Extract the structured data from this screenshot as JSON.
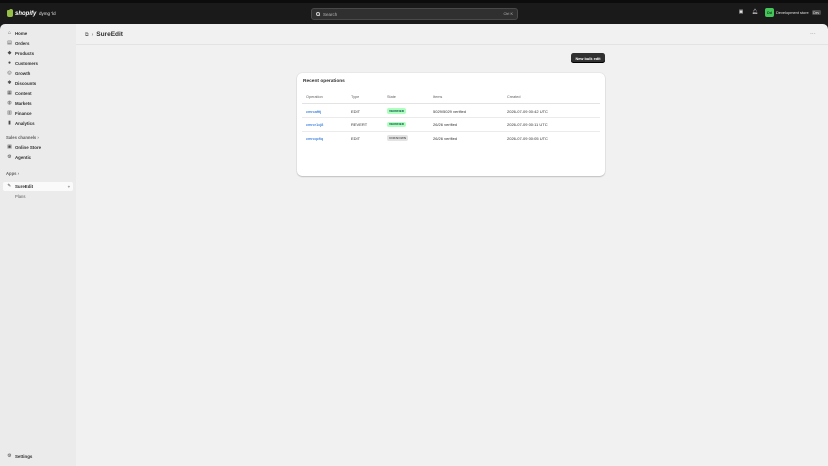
{
  "topbar": {
    "logo_text": "shopify",
    "store_name": "dymg 'ld",
    "search_placeholder": "Search",
    "search_shortcut": "Ctrl K",
    "user_initials": "Dd",
    "user_name": "Development store",
    "user_badge": "Dev"
  },
  "sidebar": {
    "items": [
      {
        "label": "Home",
        "icon": "home-icon"
      },
      {
        "label": "Orders",
        "icon": "orders-icon"
      },
      {
        "label": "Products",
        "icon": "products-icon"
      },
      {
        "label": "Customers",
        "icon": "customers-icon"
      },
      {
        "label": "Growth",
        "icon": "growth-icon"
      },
      {
        "label": "Discounts",
        "icon": "discounts-icon"
      },
      {
        "label": "Content",
        "icon": "content-icon"
      },
      {
        "label": "Markets",
        "icon": "markets-icon"
      },
      {
        "label": "Finance",
        "icon": "finance-icon"
      },
      {
        "label": "Analytics",
        "icon": "analytics-icon"
      }
    ],
    "sales_channels_heading": "Sales channels",
    "sales_channels": [
      {
        "label": "Online Store"
      },
      {
        "label": "Agentic"
      }
    ],
    "apps_heading": "Apps",
    "apps": [
      {
        "label": "SureEdit"
      }
    ],
    "app_subitem": "Plans",
    "settings_label": "Settings"
  },
  "page": {
    "title": "SureEdit",
    "primary_button": "New bulk edit"
  },
  "operations": {
    "title": "Recent operations",
    "columns": [
      "Operation",
      "Type",
      "State",
      "Items",
      "Created"
    ],
    "rows": [
      {
        "operation": "cmrcafttj",
        "type": "EDIT",
        "state": "VERIFIED",
        "items": "5029/5029 verified",
        "created": "2026-07-09 00:42 UTC"
      },
      {
        "operation": "cmrcr1cj8",
        "type": "REVERT",
        "state": "VERIFIED",
        "items": "26/26 verified",
        "created": "2026-07-09 00:11 UTC"
      },
      {
        "operation": "cmrcqcfiq",
        "type": "EDIT",
        "state": "UNKNOWN",
        "items": "26/26 verified",
        "created": "2026-07-09 00:05 UTC"
      }
    ]
  },
  "colors": {
    "topbar": "#1a1a1a",
    "sidebar": "#ebebeb",
    "content": "#f1f1f1",
    "link": "#005bd3",
    "verified_badge_bg": "#affebf",
    "verified_badge_fg": "#014b40",
    "unknown_badge_bg": "#e3e3e3",
    "primary_button": "#303030"
  }
}
